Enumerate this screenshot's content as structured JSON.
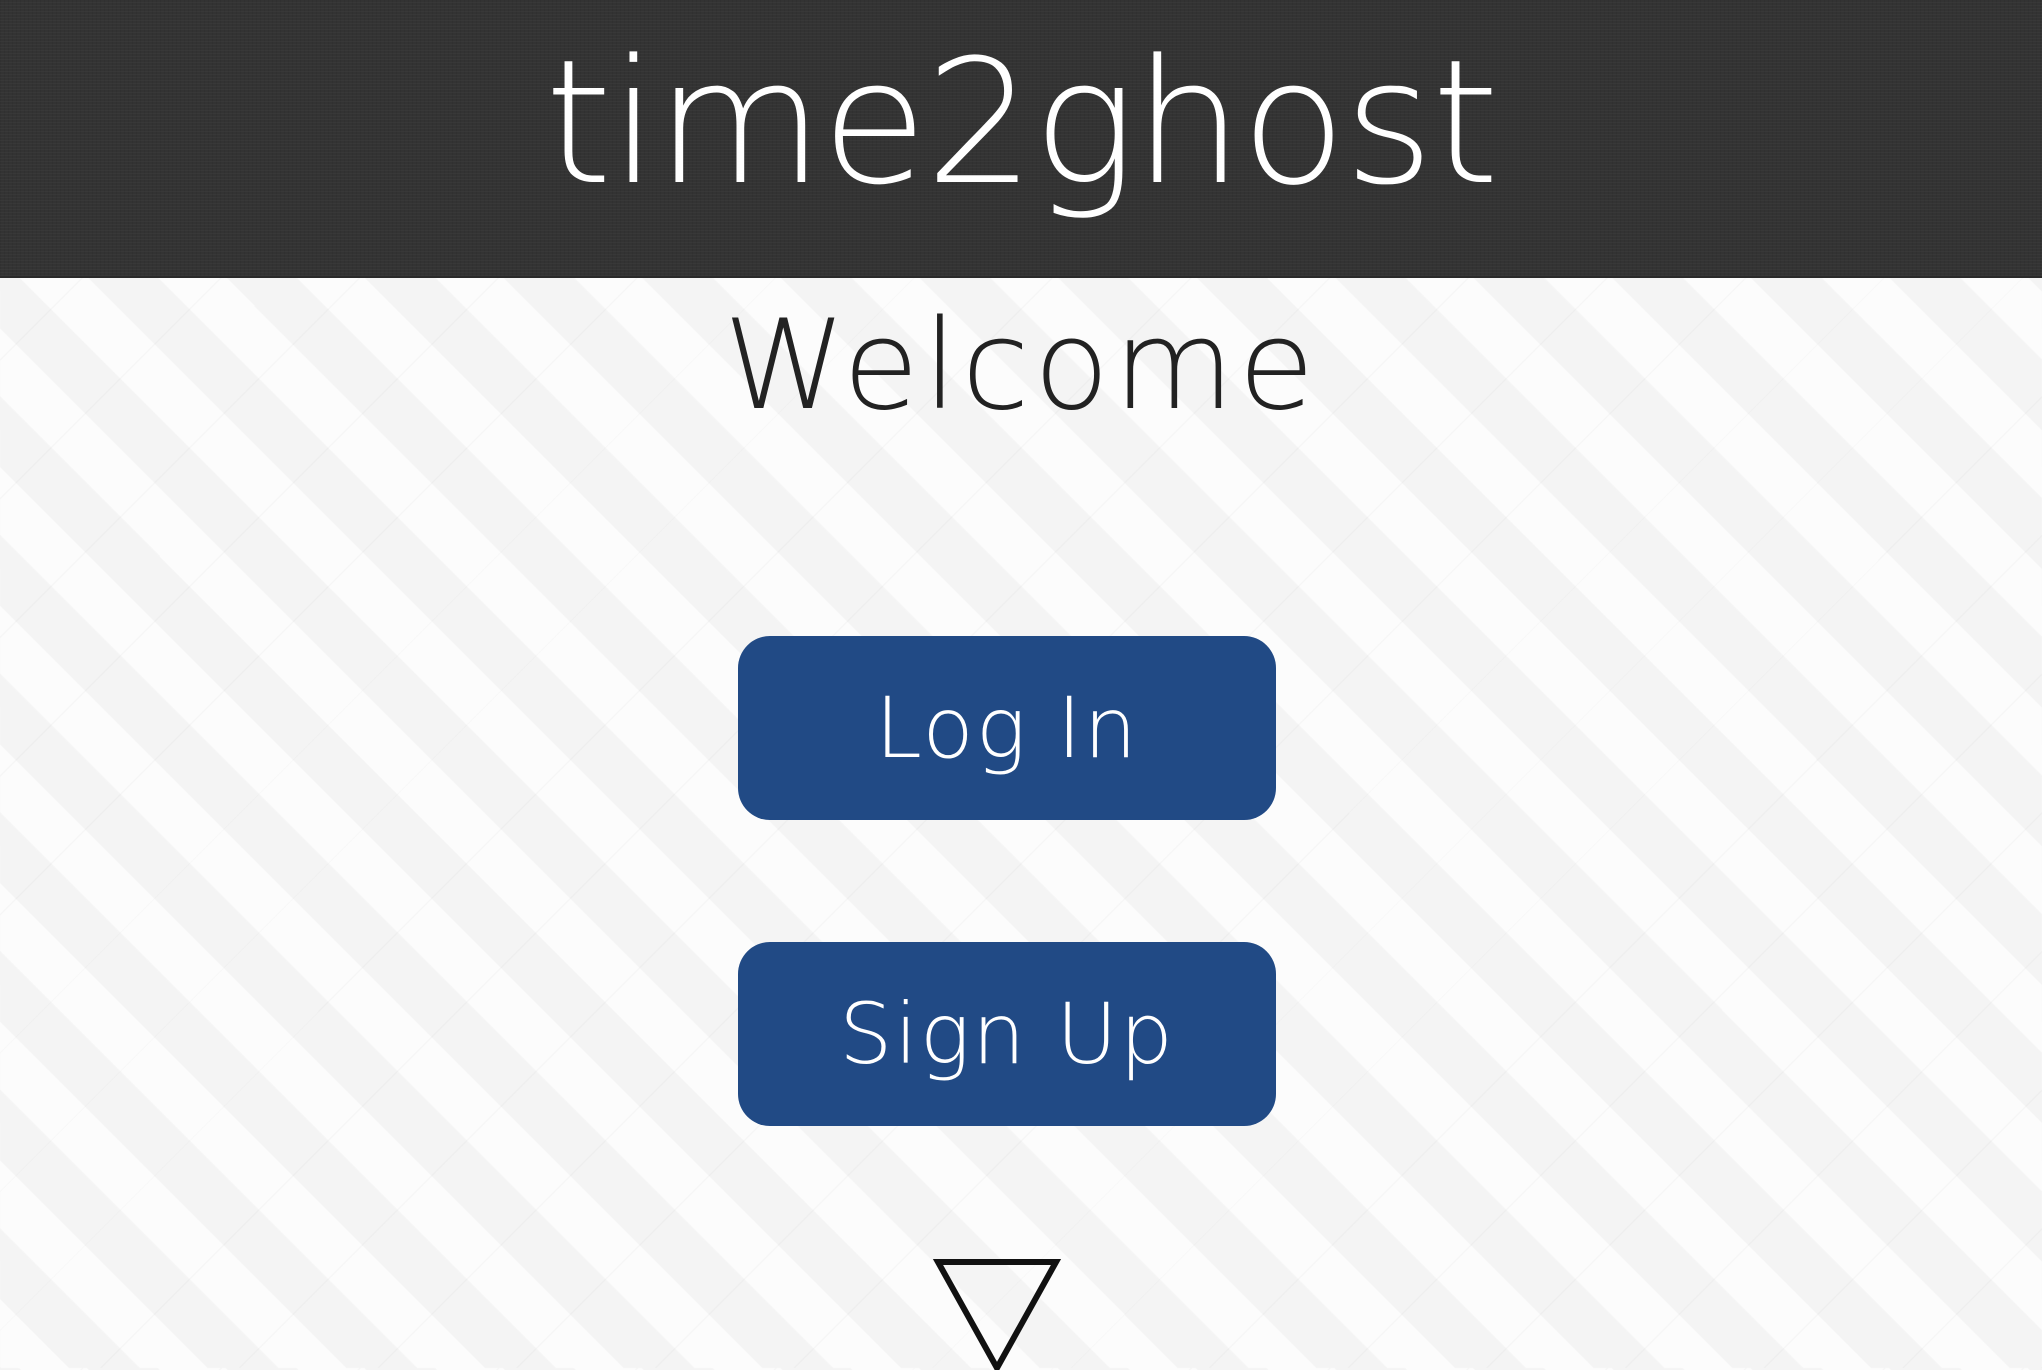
{
  "app": {
    "title": "time2ghost"
  },
  "main": {
    "heading": "Welcome",
    "buttons": {
      "login_label": "Log In",
      "signup_label": "Sign Up"
    }
  },
  "icons": {
    "scroll": "down-triangle-icon"
  },
  "colors": {
    "header_bg": "#333333",
    "page_bg": "#f7f7f7",
    "button_bg": "#214a85",
    "button_text": "#ffffff",
    "heading_text": "#222222"
  }
}
